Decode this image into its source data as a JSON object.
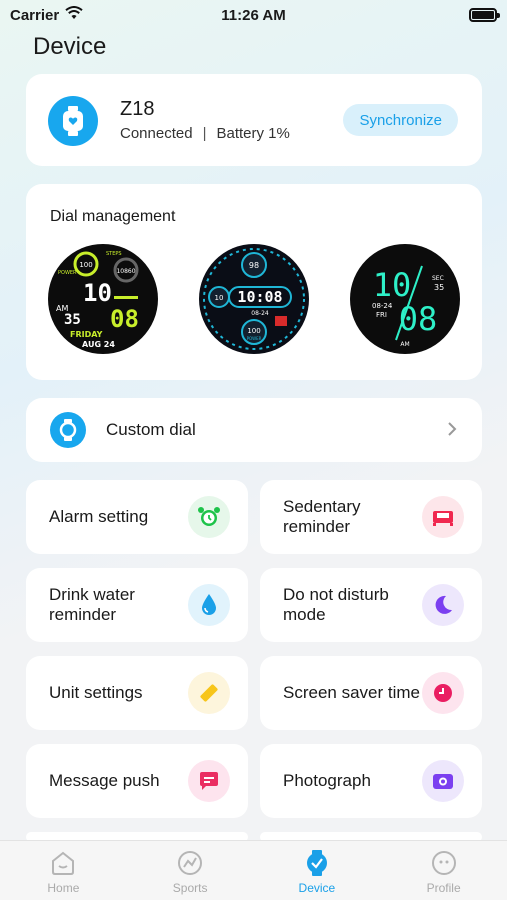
{
  "status_bar": {
    "carrier": "Carrier",
    "time": "11:26 AM"
  },
  "page": {
    "title": "Device"
  },
  "device": {
    "name": "Z18",
    "connection": "Connected",
    "separator": "|",
    "battery": "Battery 1%",
    "sync_label": "Synchronize"
  },
  "dial_management": {
    "title": "Dial management",
    "dials": [
      {
        "hour": "10",
        "minute": "08",
        "seconds": "35",
        "ampm": "AM",
        "day": "FRIDAY",
        "date": "AUG 24",
        "steps": "10860",
        "power": "100",
        "steps_label": "STEPS",
        "power_label": "POWER"
      },
      {
        "time": "10:08",
        "date": "08-24",
        "top_value": "98",
        "left_value": "10",
        "bottom_value": "100",
        "bottom_label": "POWER"
      },
      {
        "hour": "10",
        "minute": "08",
        "date": "08-24",
        "day": "FRI",
        "sec_label": "SEC",
        "seconds": "35",
        "ampm": "AM"
      }
    ]
  },
  "custom_dial": {
    "label": "Custom dial"
  },
  "tiles": [
    {
      "label": "Alarm setting",
      "icon": "alarm-clock-icon",
      "bg": "#e6f7ea",
      "fg": "#1ec34a"
    },
    {
      "label": "Sedentary reminder",
      "icon": "sofa-icon",
      "bg": "#fde6ea",
      "fg": "#f0284f"
    },
    {
      "label": "Drink water reminder",
      "icon": "water-drop-icon",
      "bg": "#e1f3fc",
      "fg": "#1aa0e8"
    },
    {
      "label": "Do not disturb mode",
      "icon": "moon-icon",
      "bg": "#ede7fc",
      "fg": "#7b3ff0"
    },
    {
      "label": "Unit settings",
      "icon": "ruler-icon",
      "bg": "#fdf5dc",
      "fg": "#f7c51a"
    },
    {
      "label": "Screen saver time",
      "icon": "clock-icon",
      "bg": "#fde4ee",
      "fg": "#ea1e62"
    },
    {
      "label": "Message push",
      "icon": "message-icon",
      "bg": "#fde4ee",
      "fg": "#ea2e62"
    },
    {
      "label": "Photograph",
      "icon": "camera-icon",
      "bg": "#ede7fc",
      "fg": "#7b3ff0"
    }
  ],
  "tabbar": [
    {
      "label": "Home",
      "icon": "home-icon",
      "active": false
    },
    {
      "label": "Sports",
      "icon": "sports-icon",
      "active": false
    },
    {
      "label": "Device",
      "icon": "device-watch-icon",
      "active": true
    },
    {
      "label": "Profile",
      "icon": "profile-icon",
      "active": false
    }
  ],
  "colors": {
    "accent": "#1aa0e8",
    "background": "#f2f3f5",
    "card": "#ffffff"
  }
}
